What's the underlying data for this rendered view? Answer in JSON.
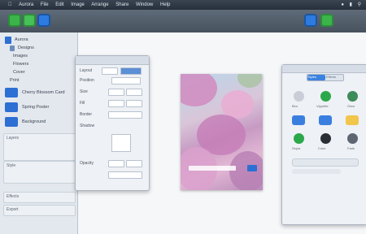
{
  "colors": {
    "menubar": "#27303b",
    "toolbar": "#47525e",
    "accent_blue": "#2d6fd3",
    "accent_green": "#3bb54a"
  },
  "menubar": {
    "items": [
      "Aurora",
      "File",
      "Edit",
      "Image",
      "Arrange",
      "Share",
      "Window",
      "Help"
    ]
  },
  "toolbar": {
    "title": "",
    "icons": [
      "share-icon",
      "export-icon",
      "import-icon",
      "preview-icon",
      "settings-icon"
    ]
  },
  "sidebar": {
    "file_tree": [
      "Aurora",
      "Designs",
      "Images",
      "Flowers",
      "Cover",
      "Print"
    ],
    "thumbnails": [
      "Cherry Blossom Card",
      "Spring Poster",
      "Background"
    ],
    "panels": [
      "Layers",
      "Style",
      "Effects",
      "Export"
    ]
  },
  "inspector": {
    "rows": [
      "Layout",
      "Position",
      "Size",
      "Fill",
      "Border",
      "Shadow",
      "Opacity"
    ]
  },
  "right_panel": {
    "tabs": [
      "Styles",
      "Effects"
    ],
    "items": [
      "Blur",
      "Vignette",
      "Glow",
      "Sepia",
      "Color",
      "Fade"
    ]
  }
}
